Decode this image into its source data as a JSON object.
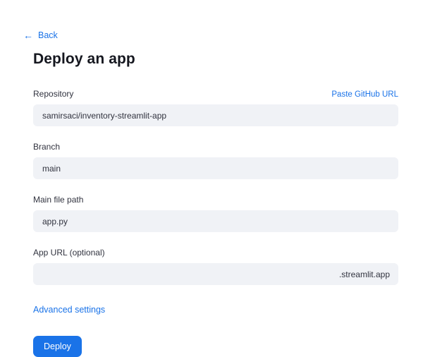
{
  "back": {
    "label": "Back"
  },
  "title": "Deploy an app",
  "form": {
    "repository": {
      "label": "Repository",
      "value": "samirsaci/inventory-streamlit-app",
      "action": "Paste GitHub URL"
    },
    "branch": {
      "label": "Branch",
      "value": "main"
    },
    "main_file": {
      "label": "Main file path",
      "value": "app.py"
    },
    "app_url": {
      "label": "App URL (optional)",
      "value": "",
      "suffix": ".streamlit.app"
    },
    "advanced_label": "Advanced settings",
    "deploy_label": "Deploy"
  },
  "colors": {
    "accent": "#1a73e8",
    "input_bg": "#f0f2f6",
    "text": "#31333f"
  }
}
